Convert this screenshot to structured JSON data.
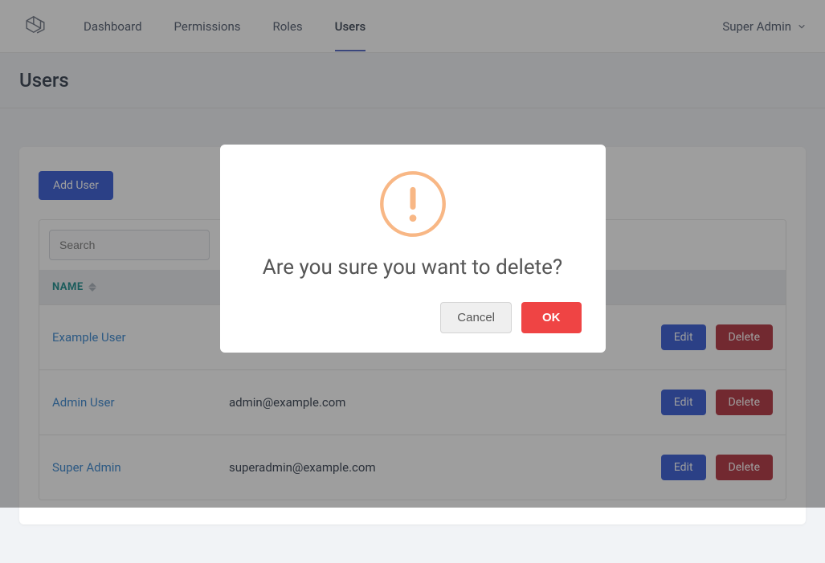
{
  "nav": {
    "items": [
      {
        "label": "Dashboard",
        "active": false
      },
      {
        "label": "Permissions",
        "active": false
      },
      {
        "label": "Roles",
        "active": false
      },
      {
        "label": "Users",
        "active": true
      }
    ],
    "user_label": "Super Admin"
  },
  "page": {
    "title": "Users"
  },
  "actions": {
    "add_user": "Add User"
  },
  "search": {
    "placeholder": "Search"
  },
  "table": {
    "columns": {
      "name": "NAME"
    },
    "rows": [
      {
        "name": "Example User",
        "email": "",
        "edit": "Edit",
        "delete": "Delete"
      },
      {
        "name": "Admin User",
        "email": "admin@example.com",
        "edit": "Edit",
        "delete": "Delete"
      },
      {
        "name": "Super Admin",
        "email": "superadmin@example.com",
        "edit": "Edit",
        "delete": "Delete"
      }
    ]
  },
  "modal": {
    "title": "Are you sure you want to delete?",
    "cancel": "Cancel",
    "ok": "OK"
  }
}
